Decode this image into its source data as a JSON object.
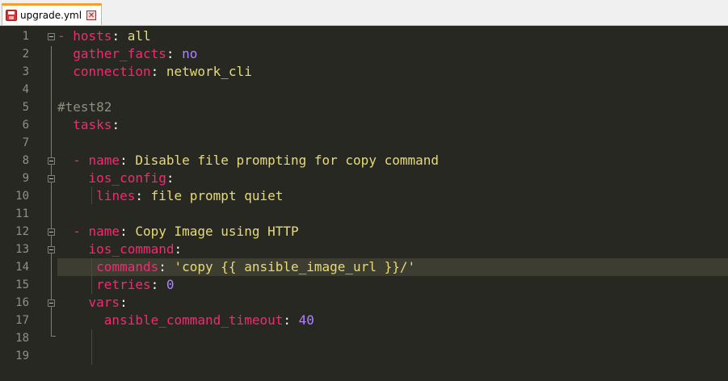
{
  "tab": {
    "filename": "upgrade.yml",
    "close_glyph": "✕"
  },
  "line_numbers": [
    "1",
    "2",
    "3",
    "4",
    "5",
    "6",
    "7",
    "8",
    "9",
    "10",
    "11",
    "12",
    "13",
    "14",
    "15",
    "16",
    "17",
    "18",
    "19"
  ],
  "code": {
    "l1_dash": "- ",
    "l1_key": "hosts",
    "l1_colon": ": ",
    "l1_val": "all",
    "l2_key": "gather_facts",
    "l2_colon": ": ",
    "l2_val": "no",
    "l3_key": "connection",
    "l3_colon": ": ",
    "l3_val": "network_cli",
    "l5_comment": "#test82",
    "l6_key": "tasks",
    "l6_colon": ":",
    "l8_dash": "- ",
    "l8_key": "name",
    "l8_colon": ": ",
    "l8_val": "Disable file prompting for copy command",
    "l9_key": "ios_config",
    "l9_colon": ":",
    "l10_key": "lines",
    "l10_colon": ": ",
    "l10_val": "file prompt quiet",
    "l12_dash": "- ",
    "l12_key": "name",
    "l12_colon": ": ",
    "l12_val": "Copy Image using HTTP",
    "l13_key": "ios_command",
    "l13_colon": ":",
    "l14_key": "commands",
    "l14_colon": ": ",
    "l14_val": "'copy {{ ansible_image_url }}/'",
    "l15_key": "retries",
    "l15_colon": ": ",
    "l15_val": "0",
    "l16_key": "vars",
    "l16_colon": ":",
    "l17_key": "ansible_command_timeout",
    "l17_colon": ": ",
    "l17_val": "40"
  },
  "colors": {
    "background": "#272822",
    "key": "#f92672",
    "string": "#e6db74",
    "number": "#ae81ff",
    "comment": "#908e7e",
    "current_line": "#3e3d32"
  }
}
